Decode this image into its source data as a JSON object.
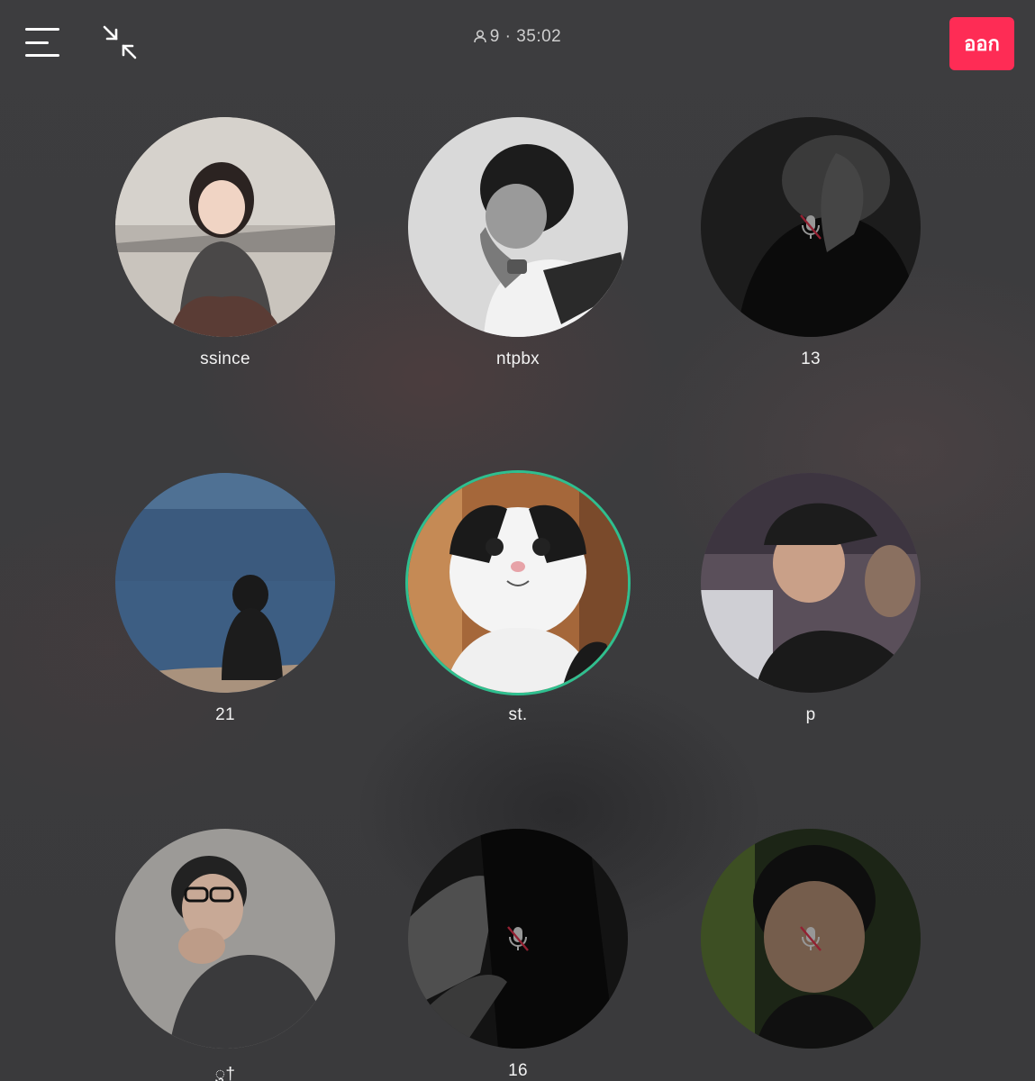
{
  "header": {
    "menu_icon": "hamburger-menu-icon",
    "minimize_icon": "minimize-arrows-icon",
    "participant_count": "9",
    "separator": "·",
    "timer": "35:02",
    "leave_label": "ออก",
    "leave_color": "#fe2c55"
  },
  "participants": [
    {
      "name": "ssince",
      "muted": false,
      "speaking": false
    },
    {
      "name": "ntpbx",
      "muted": false,
      "speaking": false
    },
    {
      "name": "13",
      "muted": true,
      "speaking": false
    },
    {
      "name": "21",
      "muted": false,
      "speaking": false
    },
    {
      "name": "st.",
      "muted": false,
      "speaking": true
    },
    {
      "name": "p",
      "muted": false,
      "speaking": false
    },
    {
      "name": "ु†",
      "muted": false,
      "speaking": false
    },
    {
      "name": "16",
      "muted": true,
      "speaking": false
    },
    {
      "name": "",
      "muted": true,
      "speaking": false
    }
  ],
  "colors": {
    "background": "#3c3c3e",
    "speaking_ring": "#2fbf8f",
    "muted_slash": "#e0334d"
  }
}
